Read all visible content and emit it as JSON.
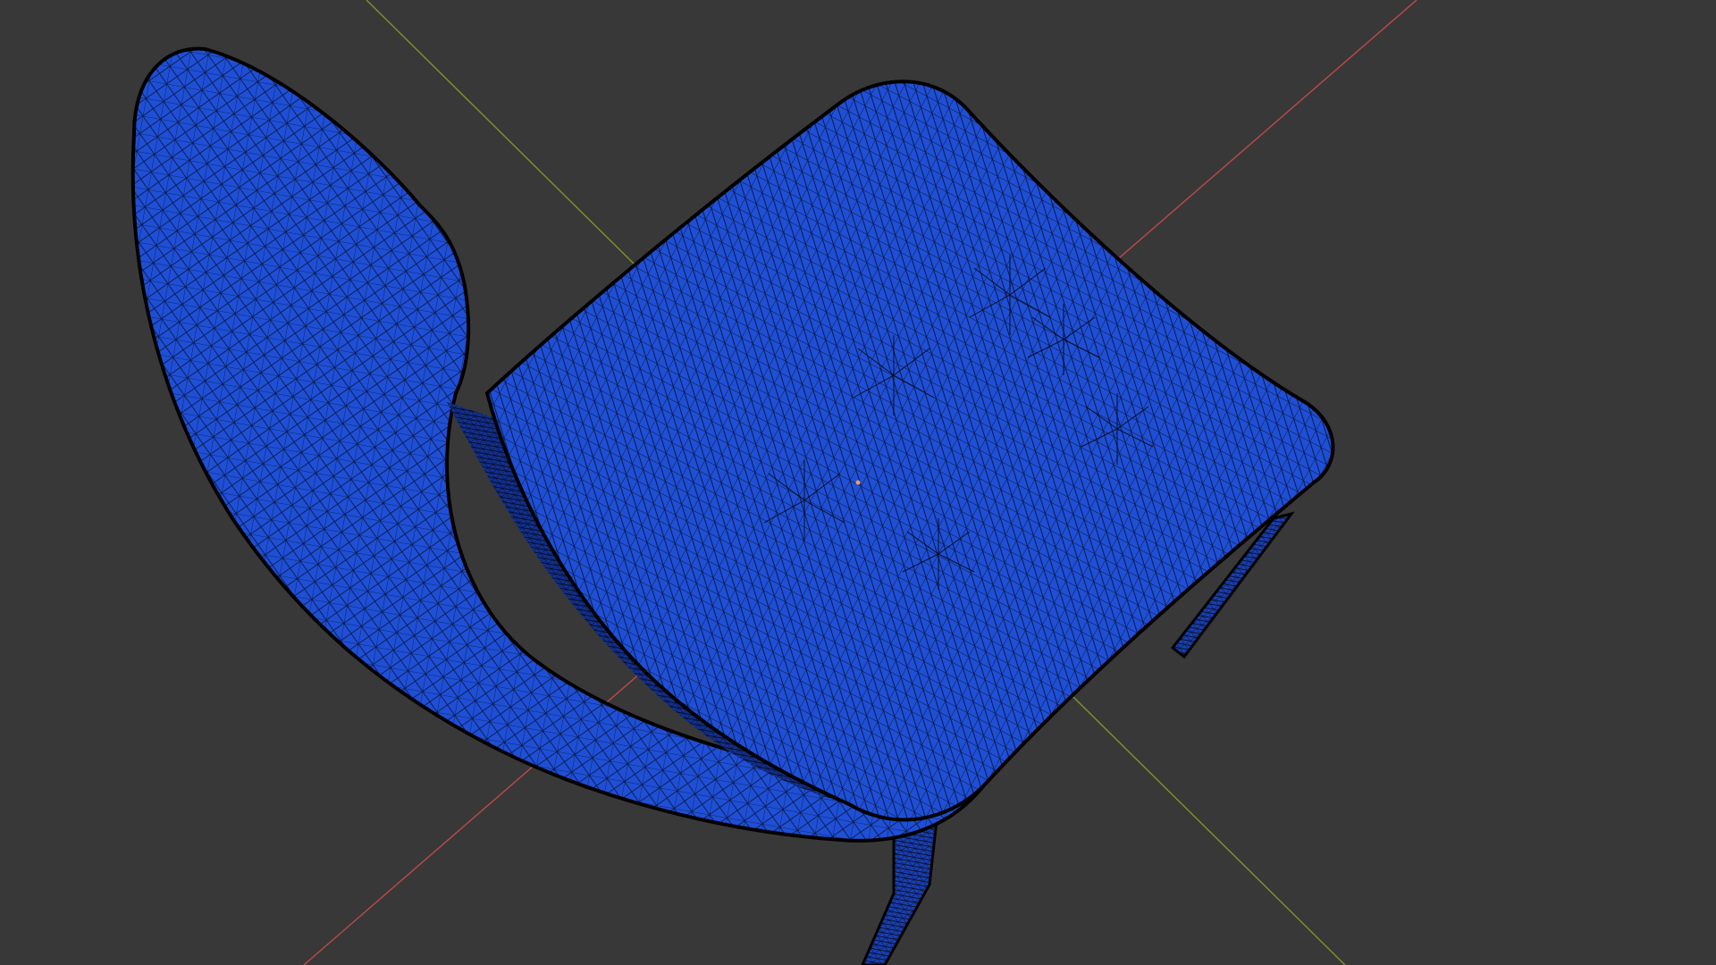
{
  "viewport": {
    "mode": "wireframe-overlay",
    "background_color": "#383838"
  },
  "axes": [
    {
      "name": "x-axis",
      "color": "#b54848"
    },
    {
      "name": "y-axis",
      "color": "#7a8f2c"
    }
  ],
  "mesh": {
    "object": "chair",
    "fill_color": "#1f4fd6",
    "wire_color": "#000000",
    "shadow_color": "#1a3fb0",
    "origin_marker_color": "#f0a050"
  }
}
